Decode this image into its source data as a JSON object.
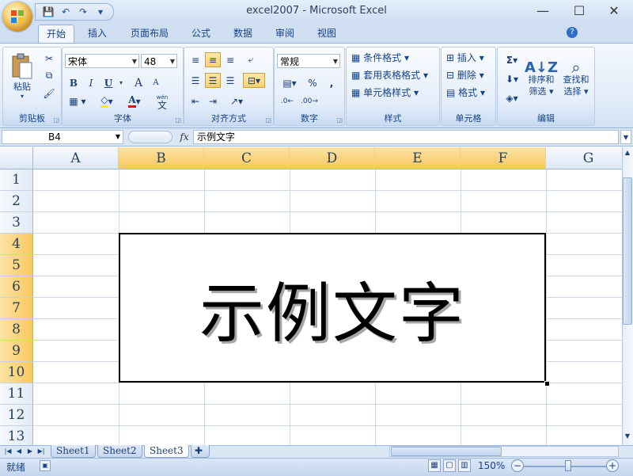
{
  "window": {
    "title": "excel2007 - Microsoft Excel",
    "minimize": "—",
    "maximize": "☐",
    "close": "✕"
  },
  "qat": {
    "save": "💾",
    "undo": "↶",
    "redo": "↷",
    "more": "▾"
  },
  "tabs": [
    {
      "label": "开始"
    },
    {
      "label": "插入"
    },
    {
      "label": "页面布局"
    },
    {
      "label": "公式"
    },
    {
      "label": "数据"
    },
    {
      "label": "审阅"
    },
    {
      "label": "视图"
    }
  ],
  "ribbon": {
    "clipboard": {
      "label": "剪贴板",
      "paste": "粘贴"
    },
    "font": {
      "label": "字体",
      "name": "宋体",
      "size": "48",
      "bold": "B",
      "italic": "I",
      "underline": "U",
      "grow": "A",
      "shrink": "A",
      "phonetic": "wén",
      "phonetic_char": "文"
    },
    "alignment": {
      "label": "对齐方式"
    },
    "number": {
      "label": "数字",
      "format": "常规",
      "percent": "%",
      "comma": ","
    },
    "styles": {
      "label": "样式",
      "conditional": "条件格式",
      "table": "套用表格格式",
      "cell": "单元格样式"
    },
    "cells": {
      "label": "单元格",
      "insert": "插入",
      "delete": "删除",
      "format": "格式"
    },
    "editing": {
      "label": "编辑",
      "sigma": "Σ",
      "sort": "排序和",
      "sort2": "筛选",
      "find": "查找和",
      "find2": "选择"
    }
  },
  "formula_bar": {
    "cell_ref": "B4",
    "fx": "fx",
    "content": "示例文字"
  },
  "grid": {
    "columns": [
      "A",
      "B",
      "C",
      "D",
      "E",
      "F",
      "G"
    ],
    "rows": [
      "1",
      "2",
      "3",
      "4",
      "5",
      "6",
      "7",
      "8",
      "9",
      "10",
      "11",
      "12",
      "13"
    ],
    "merged_text": "示例文字"
  },
  "sheets": [
    {
      "label": "Sheet1"
    },
    {
      "label": "Sheet2"
    },
    {
      "label": "Sheet3"
    }
  ],
  "status": {
    "ready": "就绪",
    "zoom": "150%",
    "zoom_minus": "−",
    "zoom_plus": "+"
  }
}
